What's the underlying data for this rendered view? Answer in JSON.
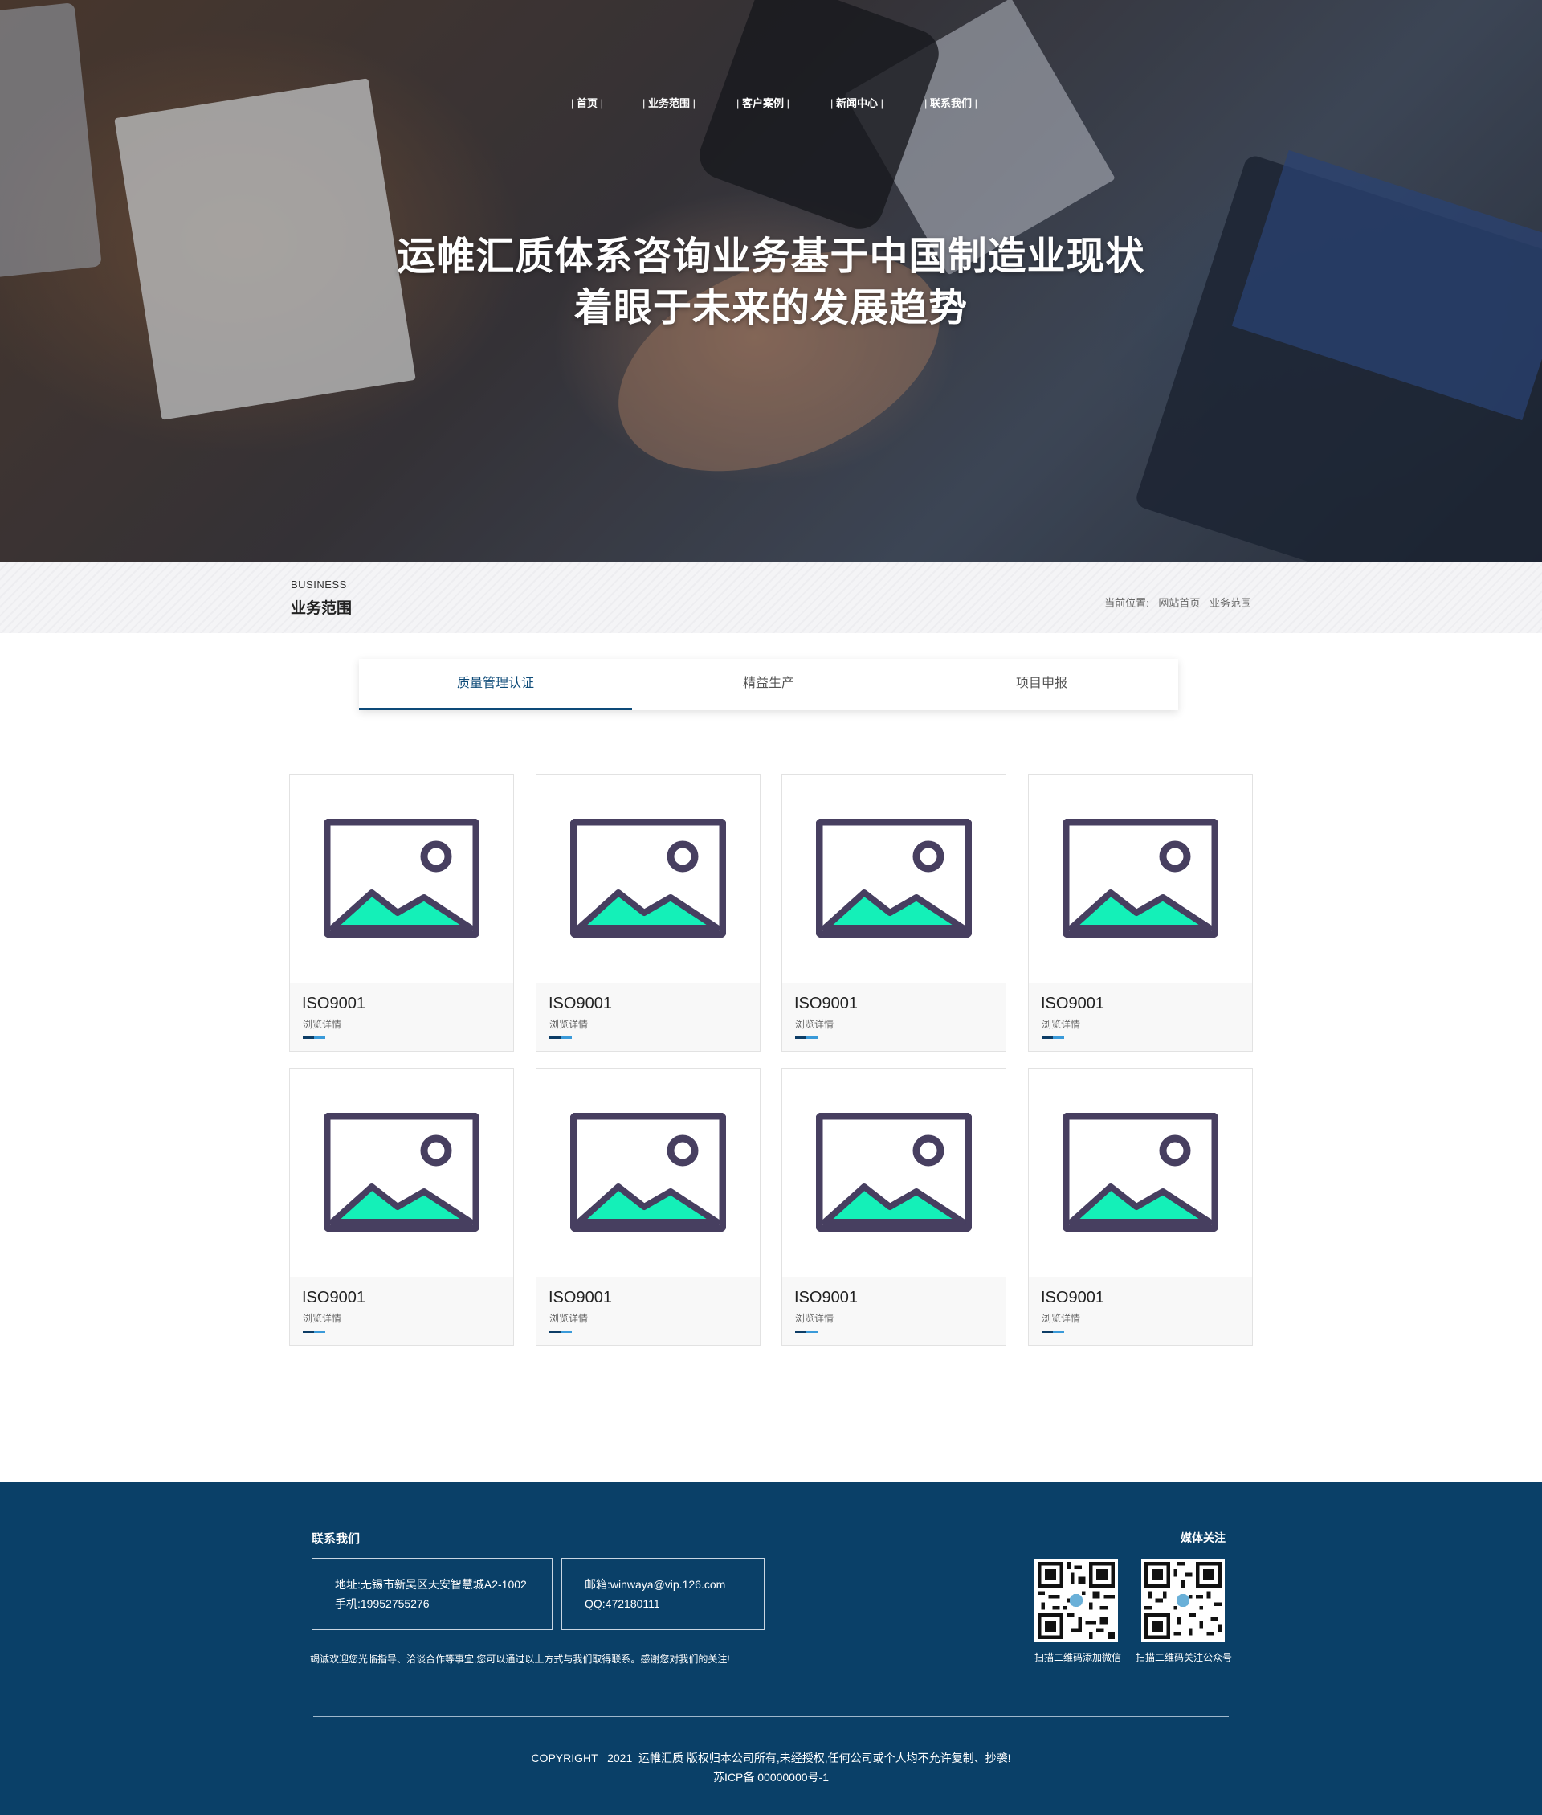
{
  "nav": {
    "items": [
      {
        "label": "首页"
      },
      {
        "label": "业务范围"
      },
      {
        "label": "客户案例"
      },
      {
        "label": "新闻中心"
      },
      {
        "label": "联系我们"
      }
    ]
  },
  "hero": {
    "line1": "运帷汇质体系咨询业务基于中国制造业现状",
    "line2": "着眼于未来的发展趋势"
  },
  "section": {
    "en": "BUSINESS",
    "zh": "业务范围",
    "crumb_prefix": "当前位置:",
    "crumb_home": "网站首页",
    "crumb_current": "业务范围"
  },
  "tabs": [
    {
      "label": "质量管理认证",
      "active": true
    },
    {
      "label": "精益生产",
      "active": false
    },
    {
      "label": "项目申报",
      "active": false
    }
  ],
  "cards": [
    {
      "title": "ISO9001",
      "sub": "浏览详情",
      "icon": "image-placeholder-icon"
    },
    {
      "title": "ISO9001",
      "sub": "浏览详情",
      "icon": "image-placeholder-icon"
    },
    {
      "title": "ISO9001",
      "sub": "浏览详情",
      "icon": "image-placeholder-icon"
    },
    {
      "title": "ISO9001",
      "sub": "浏览详情",
      "icon": "image-placeholder-icon"
    },
    {
      "title": "ISO9001",
      "sub": "浏览详情",
      "icon": "image-placeholder-icon"
    },
    {
      "title": "ISO9001",
      "sub": "浏览详情",
      "icon": "image-placeholder-icon"
    },
    {
      "title": "ISO9001",
      "sub": "浏览详情",
      "icon": "image-placeholder-icon"
    },
    {
      "title": "ISO9001",
      "sub": "浏览详情",
      "icon": "image-placeholder-icon"
    }
  ],
  "footer": {
    "contact_title": "联系我们",
    "address": "地址:无锡市新吴区天安智慧城A2-1002",
    "phone": "手机:19952755276",
    "email": "邮箱:winwaya@vip.126.com",
    "qq": "QQ:472180111",
    "note": "竭诚欢迎您光临指导、洽谈合作等事宜,您可以通过以上方式与我们取得联系。感谢您对我们的关注!",
    "media_title": "媒体关注",
    "qr1_caption": "扫描二维码添加微信",
    "qr2_caption": "扫描二维码关注公众号",
    "copyright": "COPYRIGHT   2021  运帷汇质 版权归本公司所有,未经授权,任何公司或个人均不允许复制、抄袭!",
    "icp": "苏ICP备 00000000号-1"
  },
  "colors": {
    "primary": "#0a4068",
    "accent": "#0d4a78",
    "placeholder_frame": "#473f60",
    "placeholder_mountain": "#14f0b8"
  }
}
